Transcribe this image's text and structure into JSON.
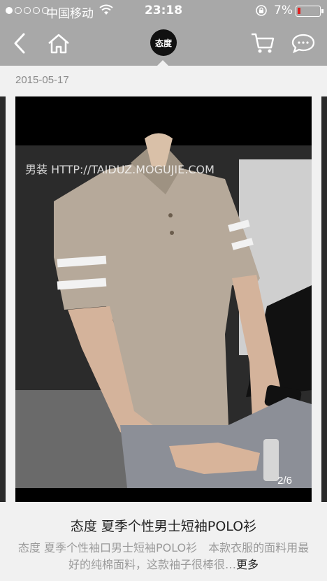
{
  "status_bar": {
    "carrier": "中国移动",
    "time": "23:18",
    "battery_pct": "7%",
    "battery_level": 0.07,
    "signal_bars_filled": 1,
    "signal_bars_total": 5
  },
  "nav": {
    "back_icon": "chevron-left-icon",
    "home_icon": "home-icon",
    "logo_text": "态度",
    "cart_icon": "cart-icon",
    "message_icon": "chat-bubble-icon"
  },
  "post": {
    "date": "2015-05-17",
    "image_watermark": "男装 HTTP://TAIDUZ.MOGUJIE.COM",
    "image_counter": "2/6",
    "title": "态度 夏季个性男士短袖POLO衫",
    "description": "态度 夏季个性袖口男士短袖POLO衫　本款衣服的面料用最好的纯棉面料，这款袖子很棒很…",
    "more_label": "更多"
  },
  "colors": {
    "top_bar": "#a8a8a8",
    "page_bg": "#f1f1f1",
    "battery_low": "#e02020"
  }
}
